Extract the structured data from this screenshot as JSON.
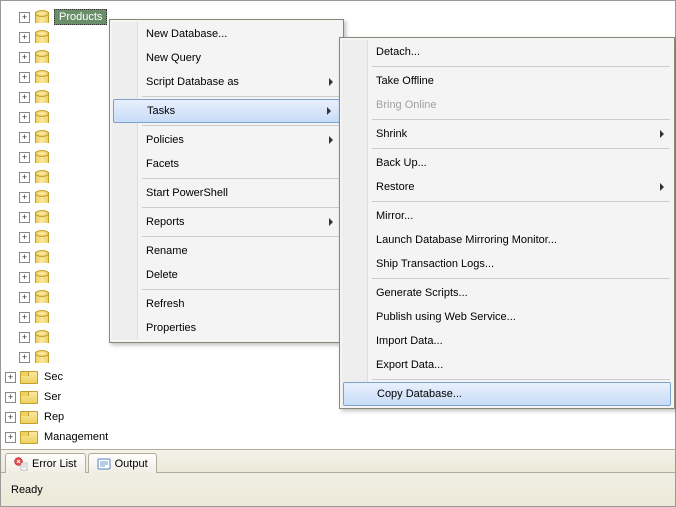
{
  "tree": {
    "selected_label": "Products",
    "db_count": 18,
    "folder_items": [
      {
        "label": "Sec"
      },
      {
        "label": "Ser"
      },
      {
        "label": "Rep"
      },
      {
        "label": "Management"
      }
    ]
  },
  "menu1": {
    "items": [
      {
        "label": "New Database...",
        "submenu": false
      },
      {
        "label": "New Query",
        "submenu": false
      },
      {
        "label": "Script Database as",
        "submenu": true
      },
      {
        "sep": true
      },
      {
        "label": "Tasks",
        "submenu": true,
        "highlighted": true
      },
      {
        "sep": true
      },
      {
        "label": "Policies",
        "submenu": true
      },
      {
        "label": "Facets",
        "submenu": false
      },
      {
        "sep": true
      },
      {
        "label": "Start PowerShell",
        "submenu": false
      },
      {
        "sep": true
      },
      {
        "label": "Reports",
        "submenu": true
      },
      {
        "sep": true
      },
      {
        "label": "Rename",
        "submenu": false
      },
      {
        "label": "Delete",
        "submenu": false
      },
      {
        "sep": true
      },
      {
        "label": "Refresh",
        "submenu": false
      },
      {
        "label": "Properties",
        "submenu": false
      }
    ]
  },
  "menu2": {
    "items": [
      {
        "label": "Detach...",
        "submenu": false
      },
      {
        "sep": true
      },
      {
        "label": "Take Offline",
        "submenu": false
      },
      {
        "label": "Bring Online",
        "submenu": false,
        "disabled": true
      },
      {
        "sep": true
      },
      {
        "label": "Shrink",
        "submenu": true
      },
      {
        "sep": true
      },
      {
        "label": "Back Up...",
        "submenu": false
      },
      {
        "label": "Restore",
        "submenu": true
      },
      {
        "sep": true
      },
      {
        "label": "Mirror...",
        "submenu": false
      },
      {
        "label": "Launch Database Mirroring Monitor...",
        "submenu": false
      },
      {
        "label": "Ship Transaction Logs...",
        "submenu": false
      },
      {
        "sep": true
      },
      {
        "label": "Generate Scripts...",
        "submenu": false
      },
      {
        "label": "Publish using Web Service...",
        "submenu": false
      },
      {
        "label": "Import Data...",
        "submenu": false
      },
      {
        "label": "Export Data...",
        "submenu": false
      },
      {
        "sep": true
      },
      {
        "label": "Copy Database...",
        "submenu": false,
        "highlighted": true
      }
    ]
  },
  "tabs": {
    "error_list": "Error List",
    "output": "Output"
  },
  "status": {
    "text": "Ready"
  }
}
